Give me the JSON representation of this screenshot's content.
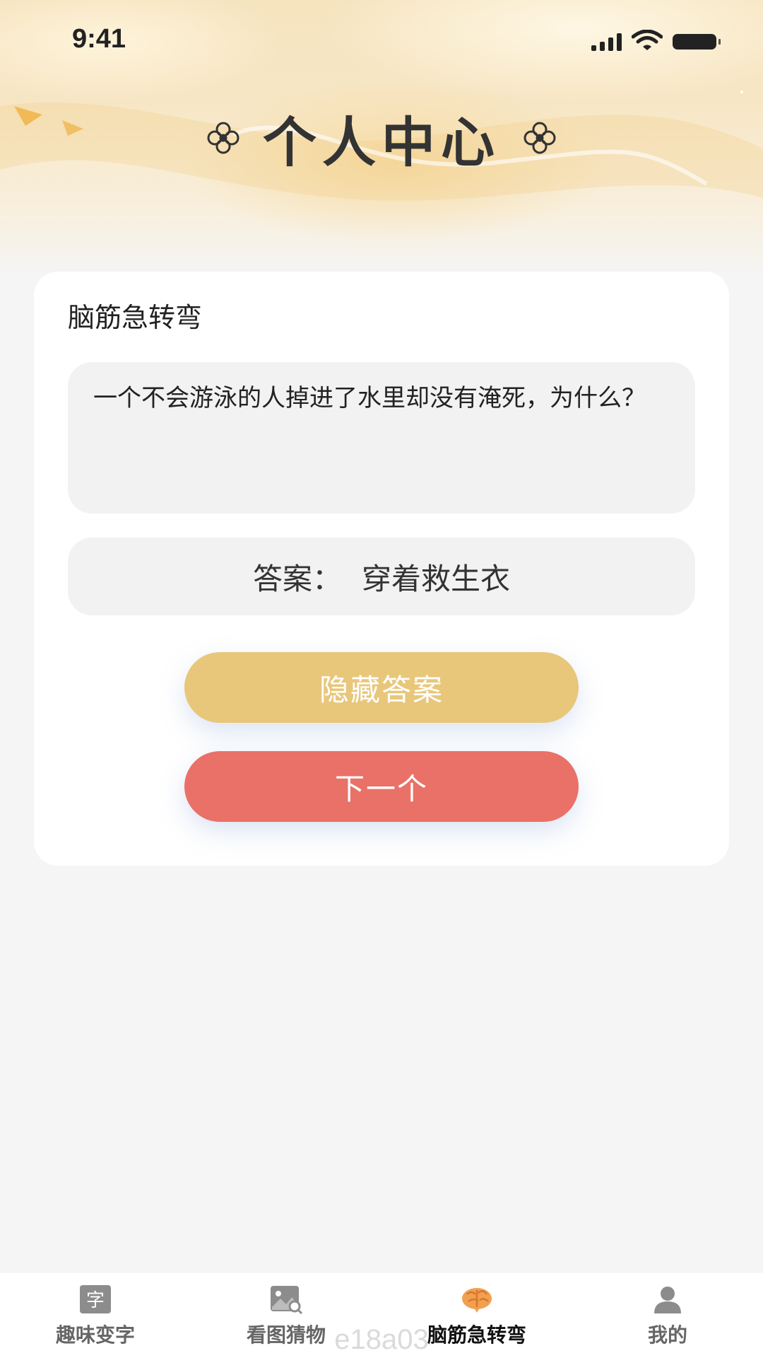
{
  "status_bar": {
    "time": "9:41"
  },
  "header": {
    "title": "个人中心"
  },
  "card": {
    "title": "脑筋急转弯",
    "question": "一个不会游泳的人掉进了水里却没有淹死，为什么？",
    "answer_label": "答案：",
    "answer": "穿着救生衣",
    "hide_button": "隐藏答案",
    "next_button": "下一个"
  },
  "tabbar": {
    "items": [
      {
        "label": "趣味变字",
        "icon": "character-icon",
        "active": false
      },
      {
        "label": "看图猜物",
        "icon": "image-search-icon",
        "active": false
      },
      {
        "label": "脑筋急转弯",
        "icon": "brain-icon",
        "active": true
      },
      {
        "label": "我的",
        "icon": "user-icon",
        "active": false
      }
    ]
  },
  "watermark": "e18a03",
  "colors": {
    "hide_button": "#e8c77b",
    "next_button": "#e97167",
    "active_icon": "#f0a050"
  }
}
